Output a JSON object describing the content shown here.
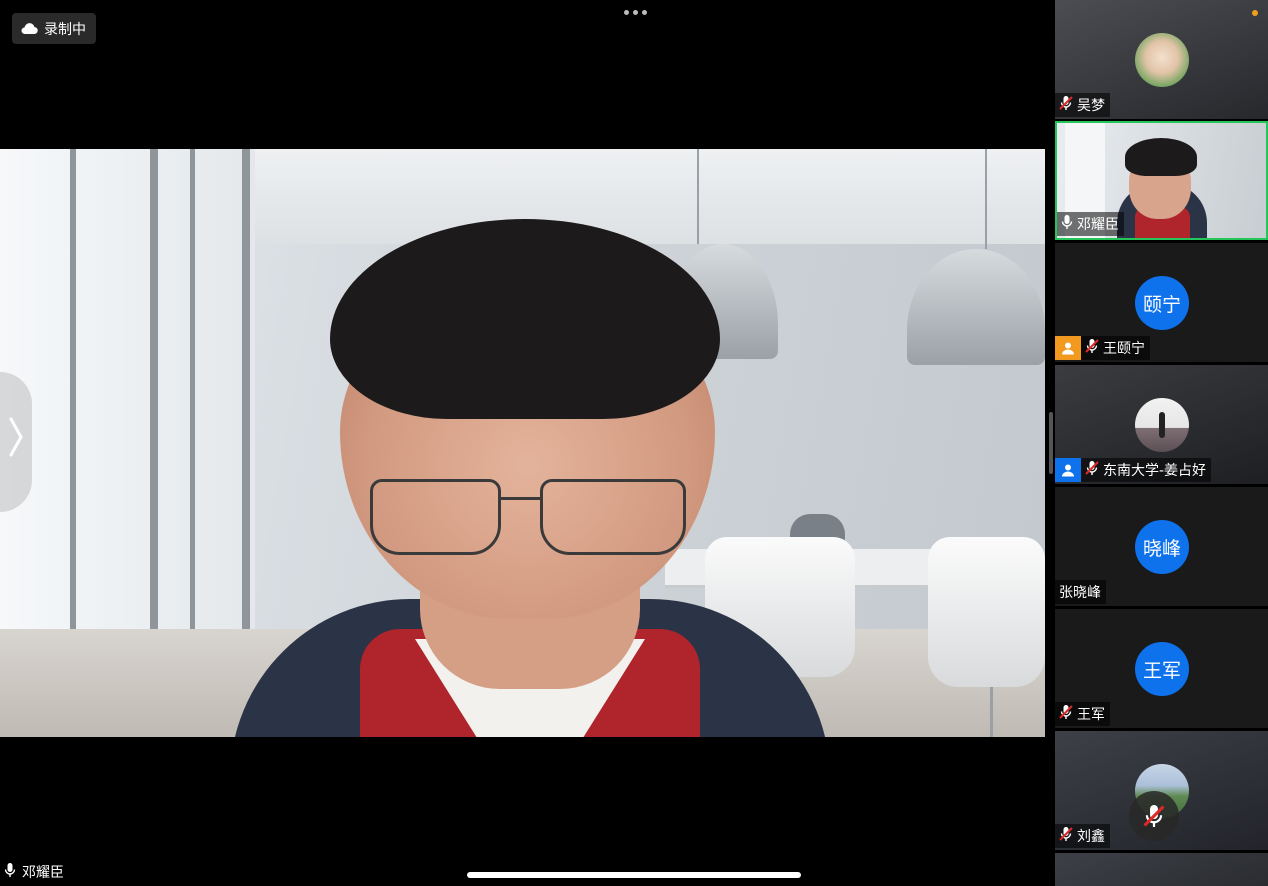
{
  "recording": {
    "label": "录制中",
    "icon": "cloud-icon"
  },
  "main_speaker": {
    "name": "邓耀臣",
    "mic_state": "on"
  },
  "gallery": {
    "participants": [
      {
        "name": "吴梦",
        "mic_state": "muted",
        "video": "avatar-photo",
        "avatar_text": "",
        "role": ""
      },
      {
        "name": "邓耀臣",
        "mic_state": "on",
        "video": "camera",
        "avatar_text": "",
        "role": "",
        "active_speaker": true
      },
      {
        "name": "王颐宁",
        "mic_state": "muted",
        "video": "off",
        "avatar_text": "颐宁",
        "role": "host"
      },
      {
        "name": "东南大学-姜占好",
        "mic_state": "muted",
        "video": "avatar-photo",
        "avatar_text": "",
        "role": "co-host"
      },
      {
        "name": "张晓峰",
        "mic_state": "none",
        "video": "off",
        "avatar_text": "晓峰",
        "role": ""
      },
      {
        "name": "王军",
        "mic_state": "muted",
        "video": "off",
        "avatar_text": "王军",
        "role": ""
      },
      {
        "name": "刘鑫",
        "mic_state": "muted",
        "video": "avatar-photo",
        "avatar_text": "",
        "role": ""
      }
    ]
  },
  "colors": {
    "active_border": "#25c55a",
    "avatar_blue": "#0e72ed",
    "host_orange": "#f29a1f",
    "cohost_blue": "#0e72ed",
    "muted_red": "#e02828"
  }
}
